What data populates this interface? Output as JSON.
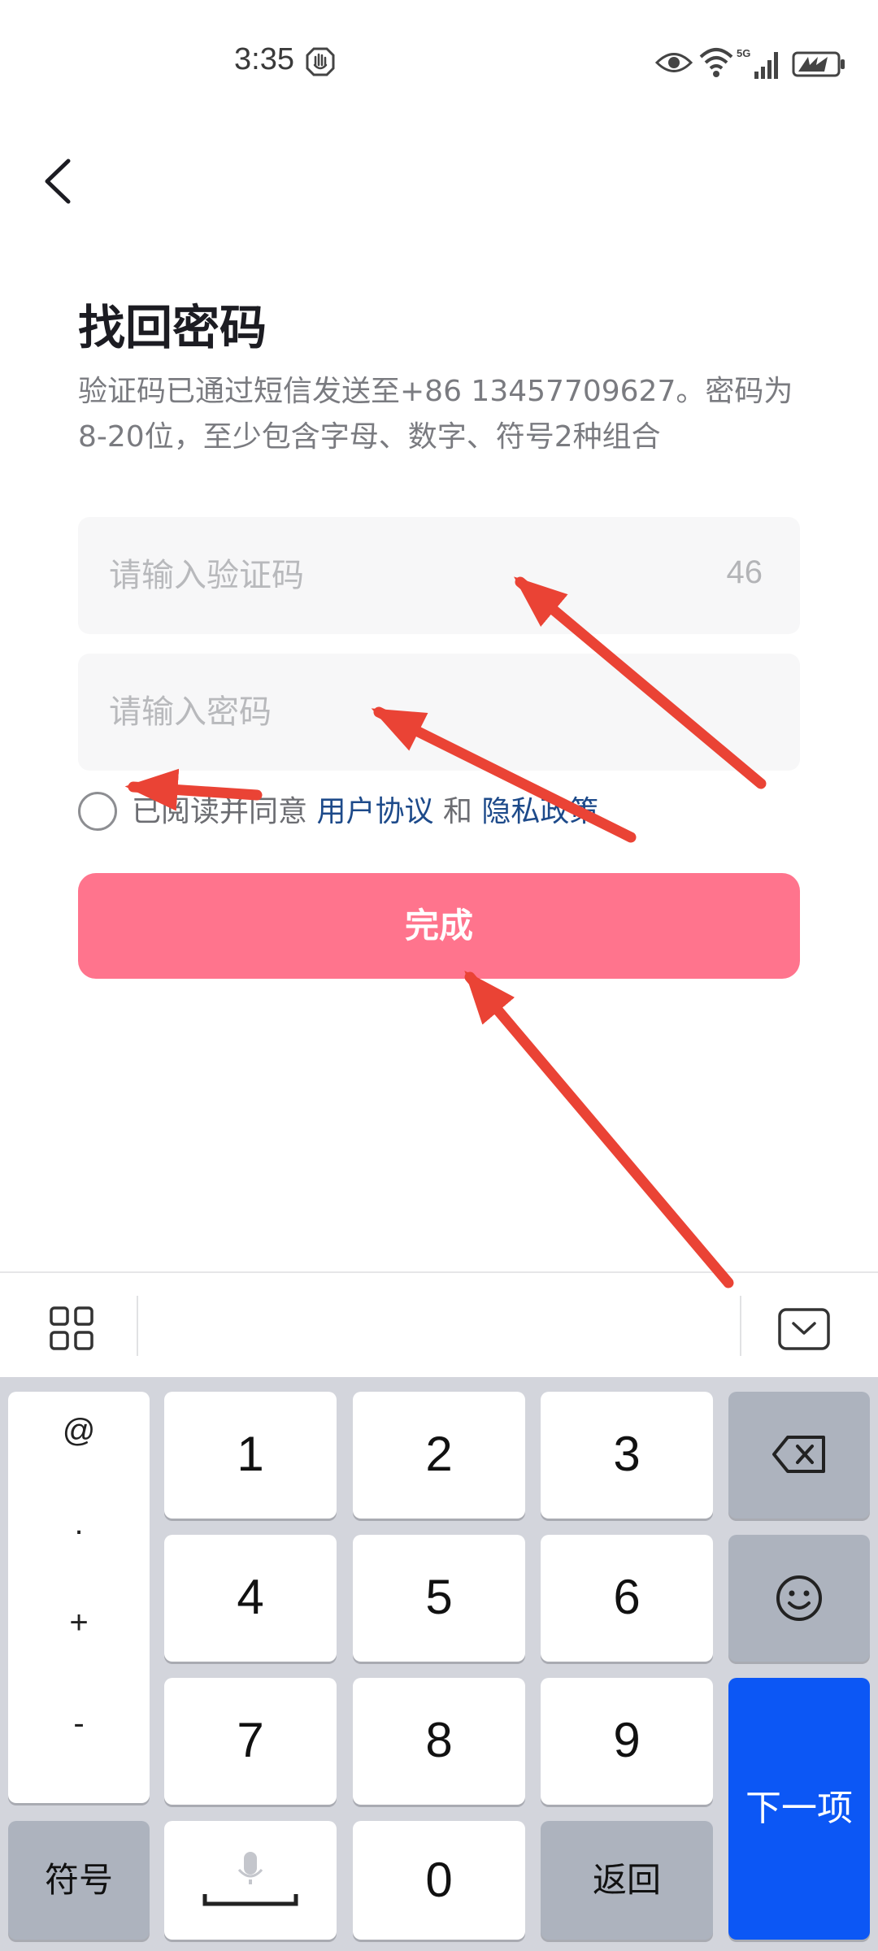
{
  "status_bar": {
    "time": "3:35",
    "network": "5G",
    "icons": [
      "hand-icon",
      "eye-icon",
      "wifi-icon",
      "signal-icon",
      "battery-charging-icon"
    ]
  },
  "header": {
    "title": "找回密码",
    "description": "验证码已通过短信发送至+86 13457709627。密码为8-20位，至少包含字母、数字、符号2种组合"
  },
  "form": {
    "code_placeholder": "请输入验证码",
    "countdown": "46",
    "password_placeholder": "请输入密码",
    "agree_prefix": "已阅读并同意",
    "user_agreement": "用户协议",
    "and": "和",
    "privacy_policy": "隐私政策",
    "submit": "完成"
  },
  "keyboard": {
    "symbols": [
      "@",
      ".",
      "+",
      "-"
    ],
    "digits": [
      "1",
      "2",
      "3",
      "4",
      "5",
      "6",
      "7",
      "8",
      "9",
      "0"
    ],
    "symbol_key": "符号",
    "return_key": "返回",
    "next_key": "下一项",
    "icons": [
      "grid-icon",
      "keyboard-hide-icon",
      "backspace-icon",
      "emoji-icon",
      "microphone-icon"
    ]
  },
  "colors": {
    "accent": "#ff748d",
    "link": "#1d4a8a",
    "enter_key": "#0c57f5",
    "annotation_arrow": "#ea4335"
  }
}
